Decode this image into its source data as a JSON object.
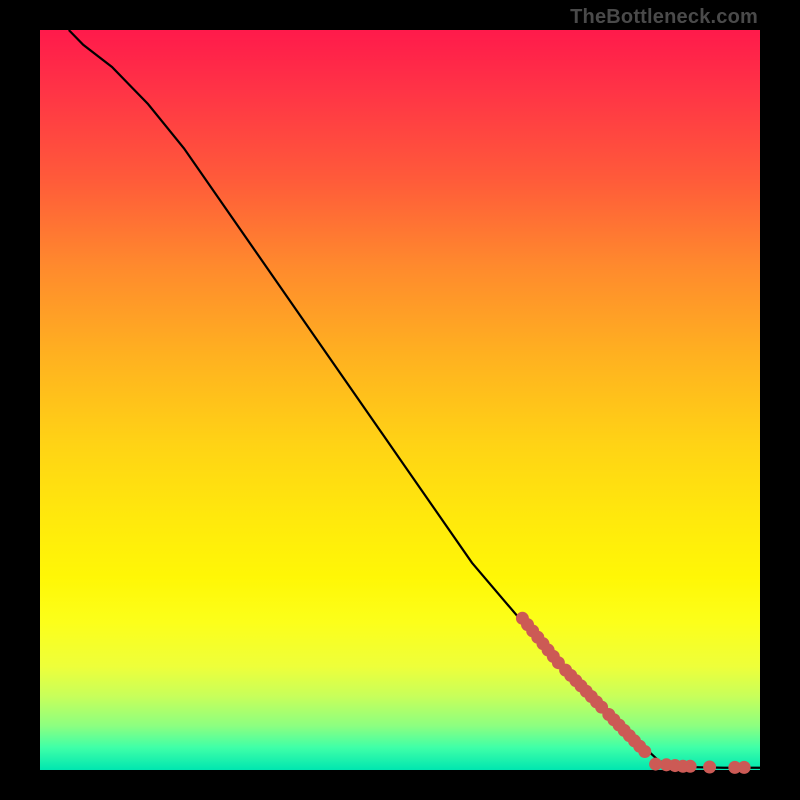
{
  "watermark": "TheBottleneck.com",
  "colors": {
    "dot": "#cc5a55",
    "curve": "#000000"
  },
  "chart_data": {
    "type": "line",
    "title": "",
    "xlabel": "",
    "ylabel": "",
    "xlim": [
      0,
      100
    ],
    "ylim": [
      0,
      100
    ],
    "grid": false,
    "curve": [
      {
        "x": 4,
        "y": 100
      },
      {
        "x": 6,
        "y": 98
      },
      {
        "x": 10,
        "y": 95
      },
      {
        "x": 15,
        "y": 90
      },
      {
        "x": 20,
        "y": 84
      },
      {
        "x": 30,
        "y": 70
      },
      {
        "x": 40,
        "y": 56
      },
      {
        "x": 50,
        "y": 42
      },
      {
        "x": 60,
        "y": 28
      },
      {
        "x": 67,
        "y": 20
      },
      {
        "x": 70,
        "y": 17
      },
      {
        "x": 75,
        "y": 12
      },
      {
        "x": 80,
        "y": 7
      },
      {
        "x": 84,
        "y": 3
      },
      {
        "x": 86,
        "y": 1.2
      },
      {
        "x": 88,
        "y": 0.6
      },
      {
        "x": 90,
        "y": 0.4
      },
      {
        "x": 95,
        "y": 0.3
      },
      {
        "x": 100,
        "y": 0.3
      }
    ],
    "dot_cluster_segments": [
      {
        "x0": 67,
        "y0": 20.5,
        "x1": 72,
        "y1": 14.5,
        "count": 8
      },
      {
        "x0": 73,
        "y0": 13.5,
        "x1": 78,
        "y1": 8.5,
        "count": 8
      },
      {
        "x0": 79,
        "y0": 7.5,
        "x1": 84,
        "y1": 2.5,
        "count": 8
      }
    ],
    "flat_dots": [
      {
        "x": 85.5,
        "y": 0.8
      },
      {
        "x": 87.0,
        "y": 0.7
      },
      {
        "x": 88.2,
        "y": 0.6
      },
      {
        "x": 89.3,
        "y": 0.5
      },
      {
        "x": 90.3,
        "y": 0.5
      },
      {
        "x": 93.0,
        "y": 0.4
      },
      {
        "x": 96.5,
        "y": 0.35
      },
      {
        "x": 97.8,
        "y": 0.35
      }
    ],
    "dot_radius_data_units": 0.9
  }
}
